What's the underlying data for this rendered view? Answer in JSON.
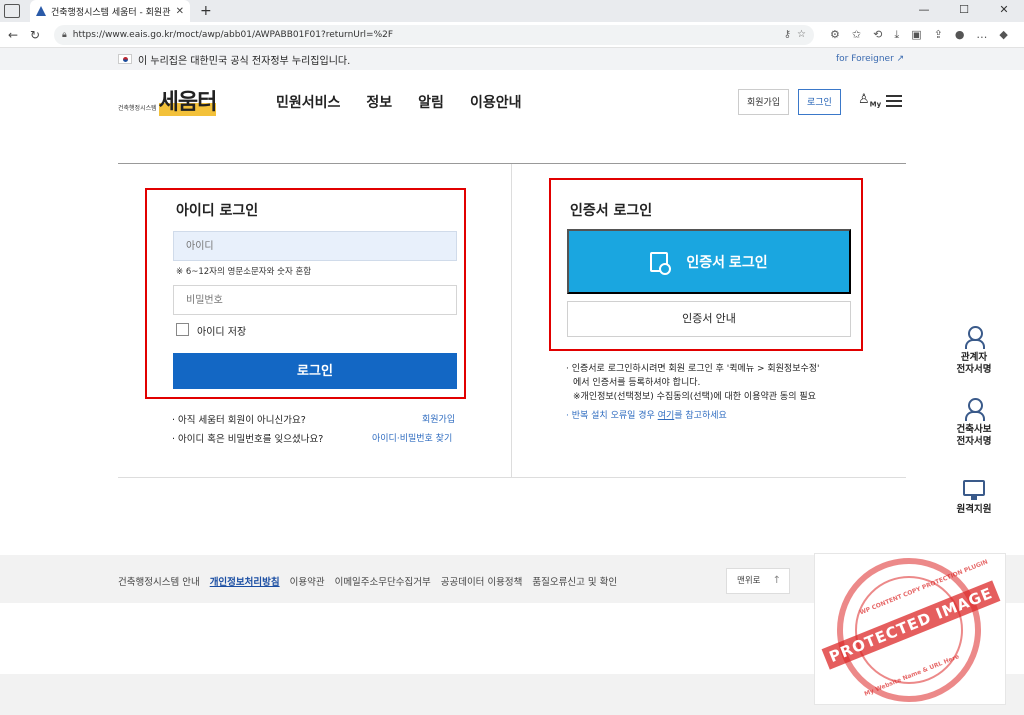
{
  "browser": {
    "tab_title": "건축행정시스템 세움터 - 회원관리",
    "tab_close": "✕",
    "new_tab": "+",
    "url": "https://www.eais.go.kr/moct/awp/abb01/AWPABB01F01?returnUrl=%2F"
  },
  "gov_banner": {
    "text": "이 누리집은 대한민국 공식 전자정부 누리집입니다.",
    "foreigner_link": "for Foreigner ↗"
  },
  "header": {
    "logo_small": "건축행정시스템",
    "logo_main": "세움터",
    "nav": [
      "민원서비스",
      "정보",
      "알림",
      "이용안내"
    ],
    "join_button": "회원가입",
    "login_button": "로그인",
    "my_label": "My"
  },
  "id_login": {
    "title": "아이디 로그인",
    "id_placeholder": "아이디",
    "id_hint": "※ 6~12자의 영문소문자와 숫자 혼합",
    "pw_placeholder": "비밀번호",
    "save_id_label": "아이디 저장",
    "login_button": "로그인",
    "q1": "· 아직 세움터 회원이 아니신가요?",
    "q1_link": "회원가입",
    "q2": "· 아이디 혹은 비밀번호를 잊으셨나요?",
    "q2_link": "아이디·비밀번호 찾기"
  },
  "cert_login": {
    "title": "인증서 로그인",
    "cert_button": "인증서 로그인",
    "guide_button": "인증서 안내",
    "note1": "· 인증서로 로그인하시려면 회원 로그인 후 '퀵메뉴 > 회원정보수정'",
    "note2": "에서 인증서를 등록하셔야 합니다.",
    "note3": "※개인정보(선택정보) 수집동의(선택)에 대한 이용약관 동의 필요",
    "note4_pre": "· 반복 설치 오류일 경우 ",
    "note4_link": "여기",
    "note4_post": "를 참고하세요"
  },
  "quick_menu": [
    {
      "line1": "관계자",
      "line2": "전자서명"
    },
    {
      "line1": "건축사보",
      "line2": "전자서명"
    },
    {
      "line1": "원격지원",
      "line2": ""
    }
  ],
  "footer": {
    "links": [
      "건축행정시스템 안내",
      "개인정보처리방침",
      "이용약관",
      "이메일주소무단수집거부",
      "공공데이터 이용정책",
      "품질오류신고 및 확인"
    ],
    "to_top": "맨위로"
  },
  "stamp": {
    "main": "PROTECTED IMAGE",
    "top": "WP CONTENT COPY PROTECTION PLUGIN",
    "bottom": "My Website Name & URL Here"
  },
  "colors": {
    "primary_button": "#1367c4",
    "cert_button": "#1aa6e0",
    "highlight_border": "#e10000",
    "link": "#2f6cc0"
  }
}
